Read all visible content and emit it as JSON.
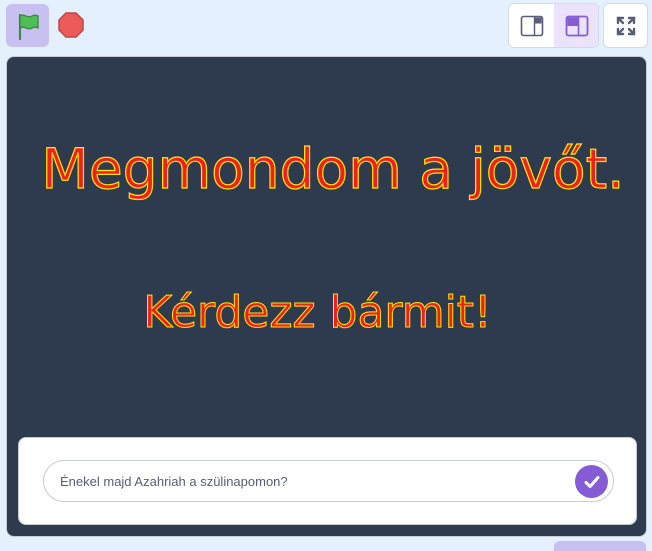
{
  "toolbar": {
    "icons": {
      "green_flag": "green-flag-icon",
      "stop": "stop-sign-icon",
      "small_stage": "small-stage-layout-icon",
      "normal_stage": "normal-stage-layout-icon",
      "fullscreen": "fullscreen-icon"
    },
    "colors": {
      "flag_green": "#4cbf56",
      "stop_red": "#ec5959",
      "accent_purple": "#855cd6"
    }
  },
  "stage": {
    "title": "Megmondom a jövőt.",
    "subtitle": "Kérdezz bármit!",
    "colors": {
      "background": "#2e3b4f",
      "text_fill": "#ef1f1f",
      "text_outline": "#ffe500"
    }
  },
  "ask": {
    "value": "Énekel majd Azahriah a szülinapomon?",
    "submit_icon": "checkmark-icon"
  }
}
